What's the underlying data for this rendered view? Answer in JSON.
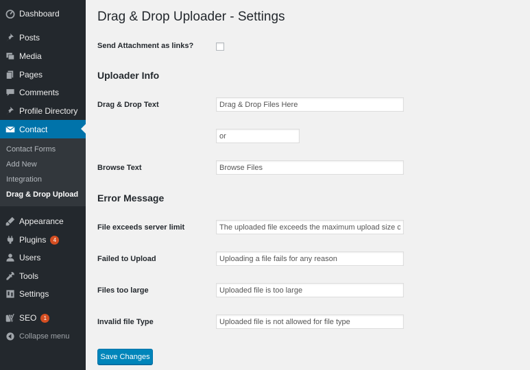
{
  "sidebar": {
    "menu": [
      {
        "label": "Dashboard",
        "icon": "dashboard-icon"
      },
      {
        "label": "Posts",
        "icon": "pin-icon"
      },
      {
        "label": "Media",
        "icon": "media-icon"
      },
      {
        "label": "Pages",
        "icon": "pages-icon"
      },
      {
        "label": "Comments",
        "icon": "comment-icon"
      },
      {
        "label": "Profile Directory",
        "icon": "pin-icon"
      },
      {
        "label": "Contact",
        "icon": "envelope-icon"
      }
    ],
    "submenu": [
      "Contact Forms",
      "Add New",
      "Integration",
      "Drag & Drop Upload"
    ],
    "menu2": [
      {
        "label": "Appearance",
        "icon": "brush-icon"
      },
      {
        "label": "Plugins",
        "icon": "plug-icon",
        "badge": "4"
      },
      {
        "label": "Users",
        "icon": "user-icon"
      },
      {
        "label": "Tools",
        "icon": "wrench-icon"
      },
      {
        "label": "Settings",
        "icon": "settings-icon"
      },
      {
        "label": "SEO",
        "icon": "yoast-icon",
        "badge": "1"
      }
    ],
    "collapse": "Collapse menu"
  },
  "main": {
    "title": "Drag & Drop Uploader - Settings",
    "attachment_label": "Send Attachment as links?",
    "uploader_section": "Uploader Info",
    "dragdrop_label": "Drag & Drop Text",
    "dragdrop_value": "Drag & Drop Files Here",
    "or_value": "or",
    "browse_label": "Browse Text",
    "browse_value": "Browse Files",
    "error_section": "Error Message",
    "server_limit_label": "File exceeds server limit",
    "server_limit_value": "The uploaded file exceeds the maximum upload size of your server",
    "failed_label": "Failed to Upload",
    "failed_value": "Uploading a file fails for any reason",
    "too_large_label": "Files too large",
    "too_large_value": "Uploaded file is too large",
    "invalid_label": "Invalid file Type",
    "invalid_value": "Uploaded file is not allowed for file type",
    "save_button": "Save Changes"
  },
  "colors": {
    "sidebar_bg": "#23282d",
    "submenu_bg": "#32373c",
    "active_bg": "#0073aa",
    "button_bg": "#0085ba",
    "badge_bg": "#d54e21"
  }
}
